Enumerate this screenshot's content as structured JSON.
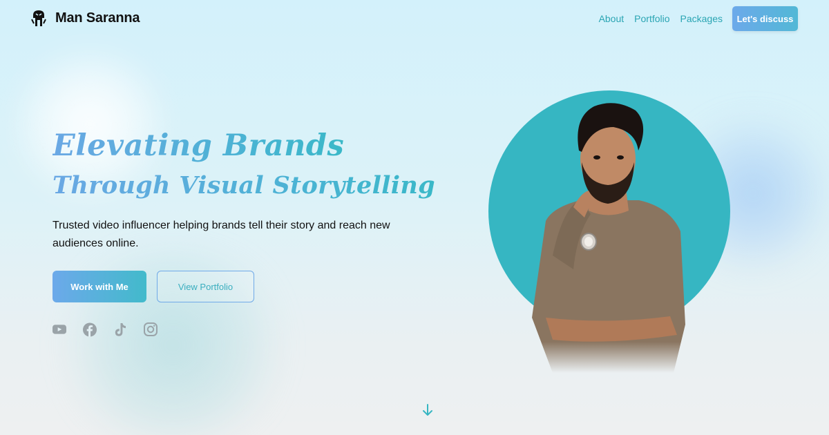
{
  "header": {
    "brand": "Man Saranna",
    "nav": [
      {
        "label": "About"
      },
      {
        "label": "Portfolio"
      },
      {
        "label": "Packages"
      }
    ],
    "cta_label": "Let's discuss"
  },
  "hero": {
    "headline_line1": "Elevating Brands",
    "headline_line2": "Through Visual Storytelling",
    "subtitle": "Trusted video influencer helping brands tell their story and reach new audiences online.",
    "primary_button": "Work with Me",
    "secondary_button": "View Portfolio",
    "social_icons": [
      "youtube-icon",
      "facebook-icon",
      "tiktok-icon",
      "instagram-icon"
    ]
  },
  "colors": {
    "accent_teal": "#36b6c2",
    "accent_blue": "#6ca9ea",
    "nav_text": "#2aa5b3",
    "icon_gray": "#9aa3a8"
  }
}
